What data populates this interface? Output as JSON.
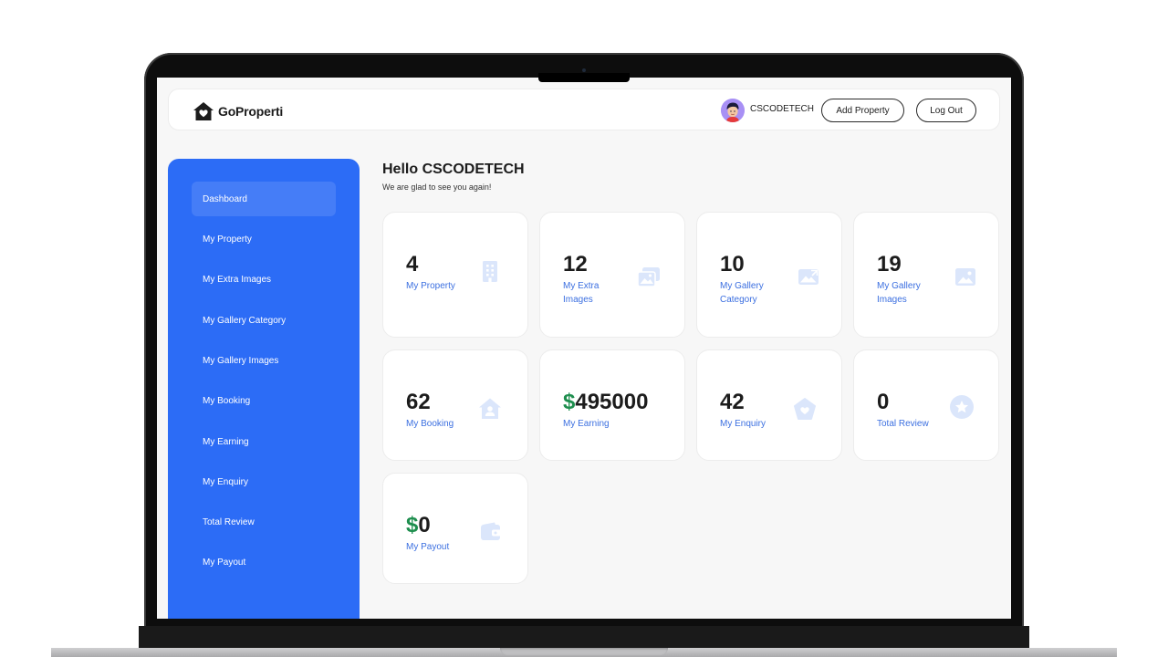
{
  "app": {
    "name": "GoProperti",
    "colors": {
      "primary": "#2c6cf6",
      "accent_money": "#1e8e4e",
      "label": "#3b6fe0",
      "icon_tint": "#dbe6fb"
    }
  },
  "header": {
    "username": "CSCODETECH",
    "add_property_label": "Add Property",
    "logout_label": "Log Out"
  },
  "sidebar": {
    "items": [
      {
        "label": "Dashboard",
        "active": true
      },
      {
        "label": "My Property"
      },
      {
        "label": "My Extra Images"
      },
      {
        "label": "My Gallery Category"
      },
      {
        "label": "My Gallery Images"
      },
      {
        "label": "My Booking"
      },
      {
        "label": "My Earning"
      },
      {
        "label": "My Enquiry"
      },
      {
        "label": "Total Review"
      },
      {
        "label": "My Payout"
      }
    ]
  },
  "main": {
    "greeting": "Hello CSCODETECH",
    "subgreeting": "We are glad to see you again!",
    "stats": [
      {
        "value": "4",
        "label": "My Property",
        "icon": "building-icon"
      },
      {
        "value": "12",
        "label": "My Extra Images",
        "icon": "images-icon"
      },
      {
        "value": "10",
        "label": "My Gallery Category",
        "icon": "gallery-category-icon"
      },
      {
        "value": "19",
        "label": "My Gallery Images",
        "icon": "image-icon"
      },
      {
        "value": "62",
        "label": "My Booking",
        "icon": "home-user-icon"
      },
      {
        "currency": "$",
        "value": "495000",
        "label": "My Earning",
        "icon": "none"
      },
      {
        "value": "42",
        "label": "My Enquiry",
        "icon": "heart-pentagon-icon"
      },
      {
        "value": "0",
        "label": "Total Review",
        "icon": "star-circle-icon"
      },
      {
        "currency": "$",
        "value": "0",
        "label": "My Payout",
        "icon": "wallet-icon"
      }
    ]
  }
}
